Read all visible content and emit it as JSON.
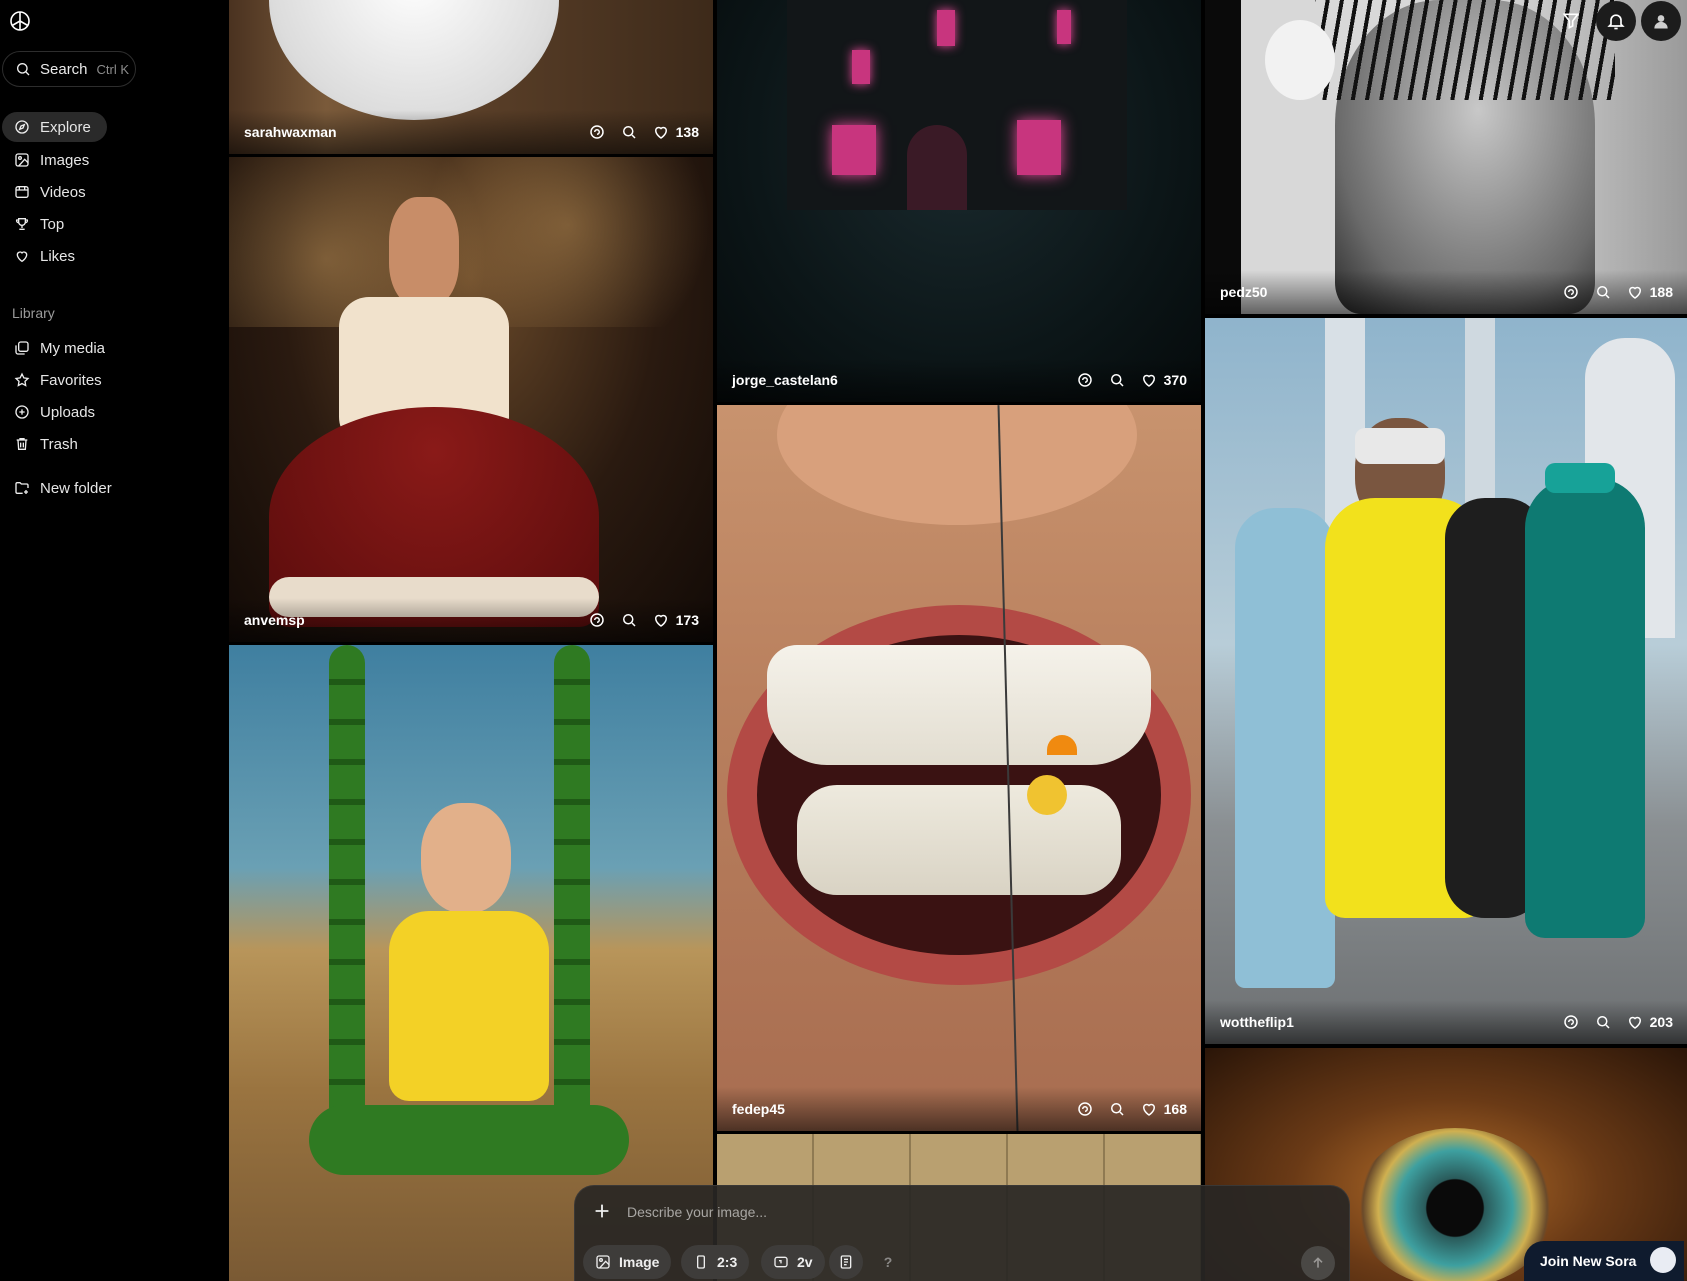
{
  "app": {
    "name": "Sora"
  },
  "search": {
    "label": "Search",
    "shortcut": "Ctrl K"
  },
  "nav": [
    {
      "label": "Explore",
      "icon": "compass-icon",
      "active": true
    },
    {
      "label": "Images",
      "icon": "image-icon"
    },
    {
      "label": "Videos",
      "icon": "video-icon"
    },
    {
      "label": "Top",
      "icon": "trophy-icon"
    },
    {
      "label": "Likes",
      "icon": "heart-icon"
    }
  ],
  "library": {
    "heading": "Library",
    "items": [
      {
        "label": "My media",
        "icon": "media-icon"
      },
      {
        "label": "Favorites",
        "icon": "star-icon"
      },
      {
        "label": "Uploads",
        "icon": "upload-icon"
      },
      {
        "label": "Trash",
        "icon": "trash-icon"
      }
    ],
    "new_folder": "New folder"
  },
  "tiles": [
    {
      "user": "sarahwaxman",
      "likes": "138"
    },
    {
      "user": "anvemsp",
      "likes": "173"
    },
    {
      "user": "",
      "likes": ""
    },
    {
      "user": "jorge_castelan6",
      "likes": "370"
    },
    {
      "user": "fedep45",
      "likes": "168"
    },
    {
      "user": "",
      "likes": ""
    },
    {
      "user": "pedz50",
      "likes": "188"
    },
    {
      "user": "wottheflip1",
      "likes": "203"
    },
    {
      "user": "",
      "likes": ""
    }
  ],
  "composer": {
    "placeholder": "Describe your image...",
    "type_label": "Image",
    "aspect_label": "2:3",
    "variations_label": "2v",
    "help_label": "?"
  },
  "promo": {
    "label": "Join New Sora"
  },
  "colors": {
    "background": "#000000",
    "active_nav": "#2a2a2a",
    "promo": "#0f1b2e"
  }
}
